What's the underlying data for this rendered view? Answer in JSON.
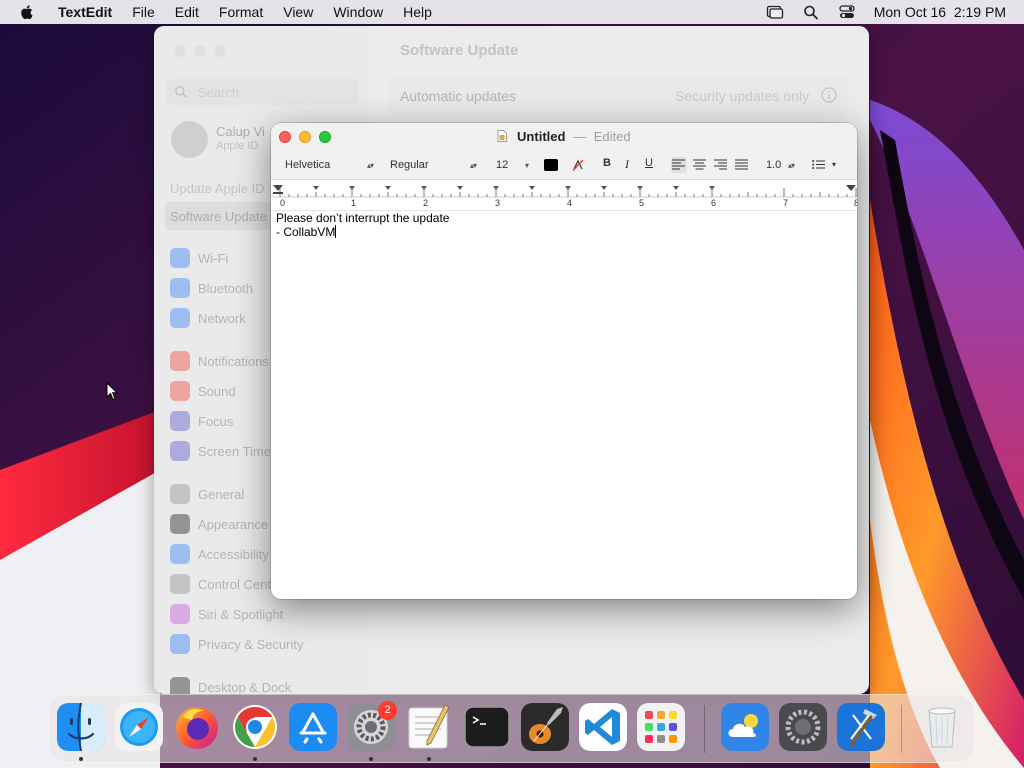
{
  "menubar": {
    "app_name": "TextEdit",
    "items": [
      "File",
      "Edit",
      "Format",
      "View",
      "Window",
      "Help"
    ],
    "clock": "Mon Oct 16  2:19 PM"
  },
  "settings_window": {
    "search_placeholder": "Search",
    "user_name": "Calup Vi",
    "user_sub": "Apple ID",
    "update_apple": "Update Apple ID",
    "selected_item": "Software Update",
    "sidebar_items": [
      "Wi-Fi",
      "Bluetooth",
      "Network",
      "Notifications",
      "Sound",
      "Focus",
      "Screen Time",
      "General",
      "Appearance",
      "Accessibility",
      "Control Center",
      "Siri & Spotlight",
      "Privacy & Security",
      "Desktop & Dock"
    ],
    "main_title": "Software Update",
    "automatic_updates_label": "Automatic updates",
    "automatic_updates_value": "Security updates only"
  },
  "textedit": {
    "doc_name": "Untitled",
    "separator": "—",
    "edited": "Edited",
    "font_family": "Helvetica",
    "font_style": "Regular",
    "font_size": "12",
    "bold": "B",
    "italic": "I",
    "underline": "U",
    "line_spacing": "1.0",
    "ruler_numbers": [
      "0",
      "1",
      "2",
      "3",
      "4",
      "5",
      "6",
      "7",
      "8"
    ],
    "text_line1": "Please don’t interrupt the update",
    "text_line2": "- CollabVM"
  },
  "dock": {
    "apps": [
      "Finder",
      "Safari",
      "Firefox",
      "Google Chrome",
      "App Store",
      "System Settings",
      "TextEdit",
      "Terminal",
      "GarageBand",
      "Visual Studio Code",
      "Launchpad",
      "Weather",
      "Utilities",
      "Xcode",
      "Trash"
    ],
    "settings_badge": "2"
  },
  "colors": {
    "accent_red": "#fe5f57",
    "accent_yellow": "#febc2e",
    "accent_green": "#28c840",
    "badge_red": "#fe3b30"
  }
}
